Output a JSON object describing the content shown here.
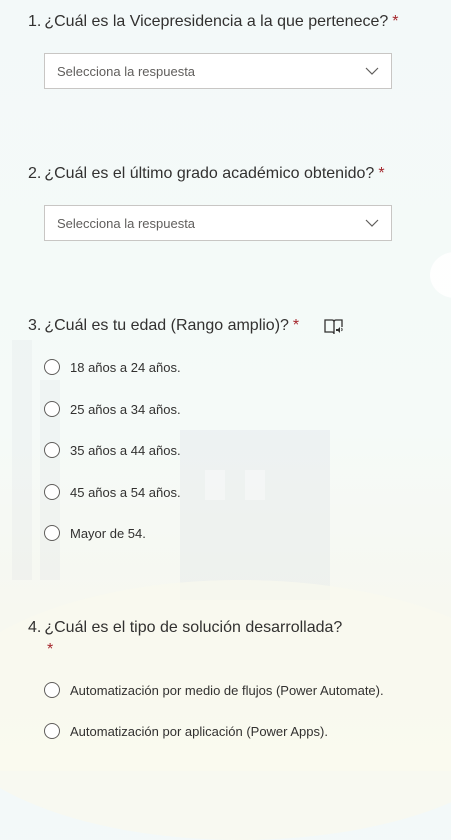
{
  "questions": [
    {
      "number": "1.",
      "title": "¿Cuál es la Vicepresidencia a la que pertenece?",
      "required_mark": "*",
      "placeholder": "Selecciona la respuesta"
    },
    {
      "number": "2.",
      "title": "¿Cuál es el último grado académico obtenido?",
      "required_mark": "*",
      "placeholder": "Selecciona la respuesta"
    },
    {
      "number": "3.",
      "title": "¿Cuál es tu edad (Rango amplio)?",
      "required_mark": "*",
      "icon": "immersive-reader-icon",
      "options": [
        "18 años a 24 años.",
        "25 años a 34 años.",
        "35 años a 44 años.",
        "45 años a 54 años.",
        "Mayor de 54."
      ]
    },
    {
      "number": "4.",
      "title": "¿Cuál es el tipo de solución desarrollada?",
      "required_mark": "*",
      "options": [
        "Automatización por medio de flujos (Power Automate).",
        "Automatización por aplicación (Power Apps)."
      ]
    }
  ],
  "colors": {
    "required": "#a4262c",
    "text": "#323130",
    "border": "#c8c6c4"
  }
}
